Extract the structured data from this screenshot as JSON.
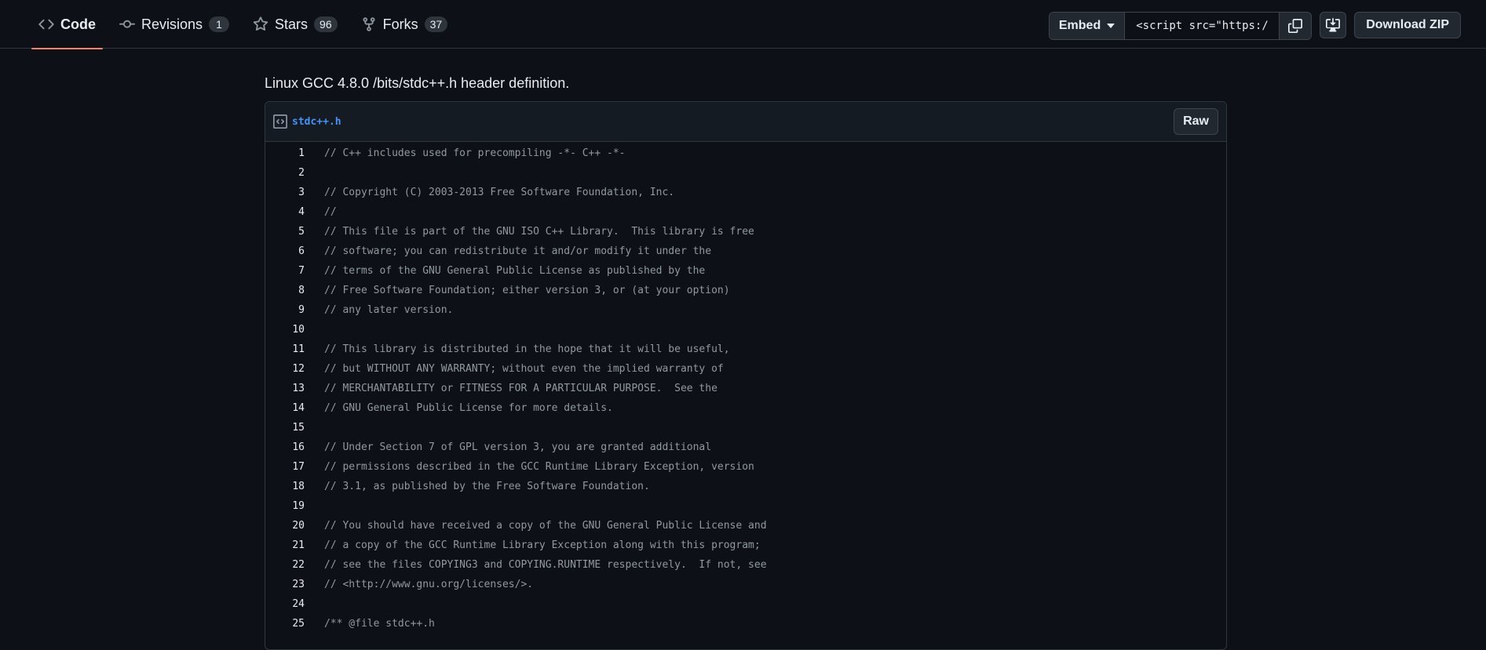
{
  "tabs": [
    {
      "label": "Code",
      "count": null
    },
    {
      "label": "Revisions",
      "count": "1"
    },
    {
      "label": "Stars",
      "count": "96"
    },
    {
      "label": "Forks",
      "count": "37"
    }
  ],
  "toolbar": {
    "embed_label": "Embed",
    "embed_value": "<script src=\"https://",
    "download_label": "Download ZIP"
  },
  "description": "Linux GCC 4.8.0 /bits/stdc++.h header definition.",
  "file": {
    "name": "stdc++.h",
    "raw_label": "Raw",
    "lines": [
      "// C++ includes used for precompiling -*- C++ -*-",
      "",
      "// Copyright (C) 2003-2013 Free Software Foundation, Inc.",
      "//",
      "// This file is part of the GNU ISO C++ Library.  This library is free",
      "// software; you can redistribute it and/or modify it under the",
      "// terms of the GNU General Public License as published by the",
      "// Free Software Foundation; either version 3, or (at your option)",
      "// any later version.",
      "",
      "// This library is distributed in the hope that it will be useful,",
      "// but WITHOUT ANY WARRANTY; without even the implied warranty of",
      "// MERCHANTABILITY or FITNESS FOR A PARTICULAR PURPOSE.  See the",
      "// GNU General Public License for more details.",
      "",
      "// Under Section 7 of GPL version 3, you are granted additional",
      "// permissions described in the GCC Runtime Library Exception, version",
      "// 3.1, as published by the Free Software Foundation.",
      "",
      "// You should have received a copy of the GNU General Public License and",
      "// a copy of the GCC Runtime Library Exception along with this program;",
      "// see the files COPYING3 and COPYING.RUNTIME respectively.  If not, see",
      "// <http://www.gnu.org/licenses/>.",
      "",
      "/** @file stdc++.h"
    ]
  }
}
